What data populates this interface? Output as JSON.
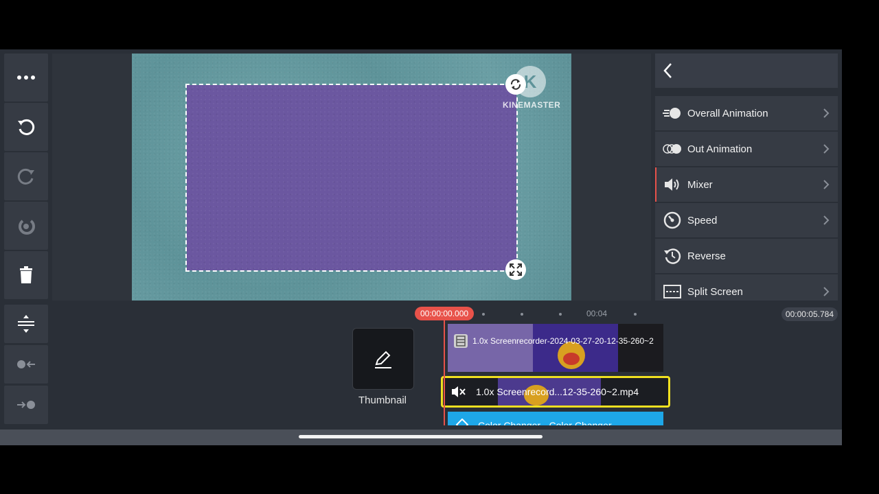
{
  "toolbar": {
    "more": "more-icon",
    "undo": "undo-icon",
    "redo": "redo-icon",
    "reset": "reset-icon",
    "delete": "trash-icon",
    "timeline_tools": [
      "split-track-icon",
      "trim-left-icon",
      "trim-right-icon"
    ]
  },
  "preview": {
    "watermark_letter": "K",
    "watermark_text": "KINEMASTER"
  },
  "panel": {
    "back": "chevron-left-icon",
    "items": [
      {
        "label": "Overall Animation",
        "icon": "overall-animation-icon",
        "chevron": true
      },
      {
        "label": "Out Animation",
        "icon": "out-animation-icon",
        "chevron": true
      },
      {
        "label": "Mixer",
        "icon": "volume-icon",
        "chevron": true
      },
      {
        "label": "Speed",
        "icon": "speedometer-icon",
        "chevron": true
      },
      {
        "label": "Reverse",
        "icon": "reverse-icon",
        "chevron": false
      },
      {
        "label": "Split Screen",
        "icon": "split-screen-icon",
        "chevron": true
      }
    ],
    "active_item": "Mixer"
  },
  "timeline": {
    "playhead_time": "00:00:00.000",
    "tick_label": "00:04",
    "total_duration": "00:00:05.784",
    "thumbnail_label": "Thumbnail",
    "video_clip_title": "1.0x Screenrecorder-2024-03-27-20-12-35-260~2",
    "audio_clip_title": "1.0x Screenrecord...12-35-260~2.mp4",
    "color_clip_title": "Color Changer - Color Changer"
  },
  "colors": {
    "accent": "#e8524a",
    "selected_clip_border": "#f0e020",
    "color_clip": "#1ea7e8"
  }
}
